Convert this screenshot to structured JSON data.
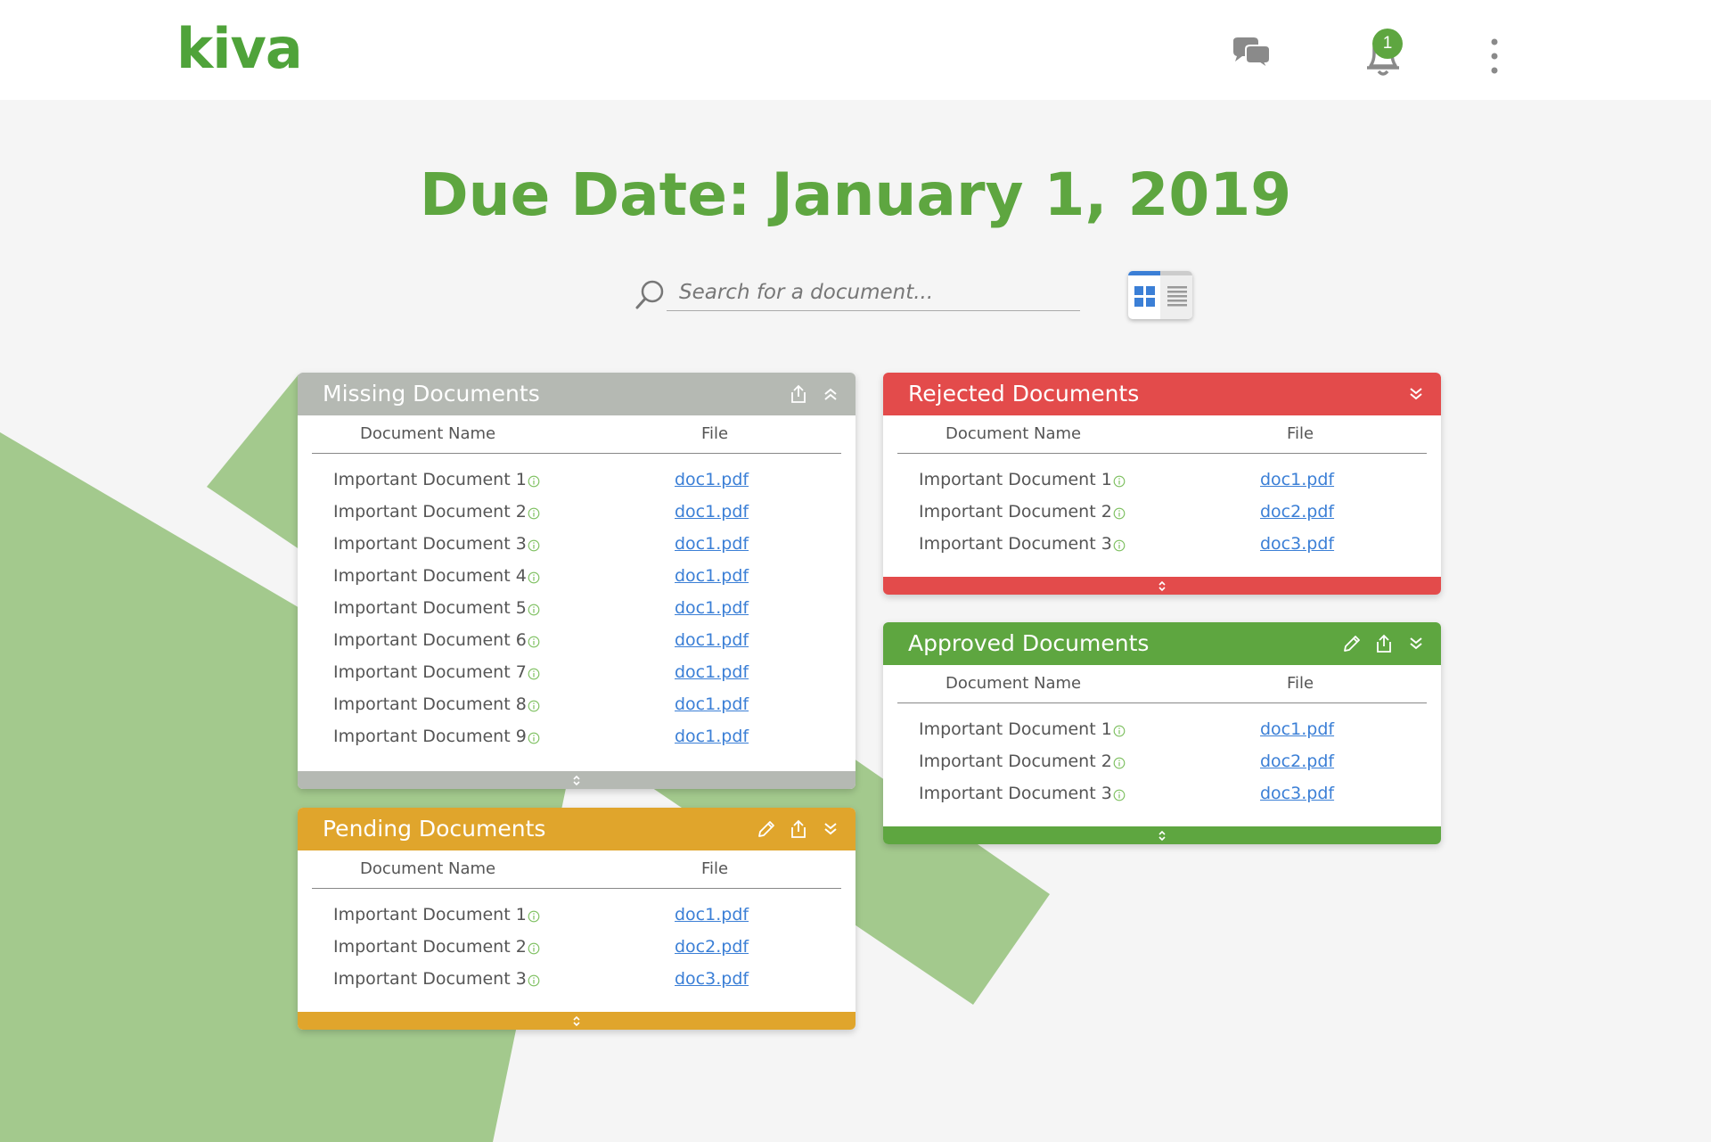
{
  "header": {
    "logo": "kiva",
    "notification_count": "1"
  },
  "page": {
    "title": "Due Date: January 1, 2019"
  },
  "search": {
    "placeholder": "Search for a document..."
  },
  "colors": {
    "brand_green": "#5ea640",
    "missing": "#b5b9b3",
    "pending": "#e0a52c",
    "rejected": "#e34b4b",
    "approved": "#5ea640",
    "link": "#3b7fd6"
  },
  "panels": {
    "missing": {
      "title": "Missing Documents",
      "col_name": "Document Name",
      "col_file": "File",
      "rows": [
        {
          "name": "Important Document 1",
          "file": "doc1.pdf"
        },
        {
          "name": "Important Document 2",
          "file": "doc1.pdf"
        },
        {
          "name": "Important Document 3",
          "file": "doc1.pdf"
        },
        {
          "name": "Important Document 4",
          "file": "doc1.pdf"
        },
        {
          "name": "Important Document 5",
          "file": "doc1.pdf"
        },
        {
          "name": "Important Document 6",
          "file": "doc1.pdf"
        },
        {
          "name": "Important Document 7",
          "file": "doc1.pdf"
        },
        {
          "name": "Important Document 8",
          "file": "doc1.pdf"
        },
        {
          "name": "Important Document 9",
          "file": "doc1.pdf"
        }
      ]
    },
    "pending": {
      "title": "Pending Documents",
      "col_name": "Document Name",
      "col_file": "File",
      "rows": [
        {
          "name": "Important Document 1",
          "file": "doc1.pdf"
        },
        {
          "name": "Important Document 2",
          "file": "doc2.pdf"
        },
        {
          "name": "Important Document 3",
          "file": "doc3.pdf"
        }
      ]
    },
    "rejected": {
      "title": "Rejected Documents",
      "col_name": "Document Name",
      "col_file": "File",
      "rows": [
        {
          "name": "Important Document 1",
          "file": "doc1.pdf"
        },
        {
          "name": "Important Document 2",
          "file": "doc2.pdf"
        },
        {
          "name": "Important Document 3",
          "file": "doc3.pdf"
        }
      ]
    },
    "approved": {
      "title": "Approved Documents",
      "col_name": "Document Name",
      "col_file": "File",
      "rows": [
        {
          "name": "Important Document 1",
          "file": "doc1.pdf"
        },
        {
          "name": "Important Document 2",
          "file": "doc2.pdf"
        },
        {
          "name": "Important Document 3",
          "file": "doc3.pdf"
        }
      ]
    }
  }
}
